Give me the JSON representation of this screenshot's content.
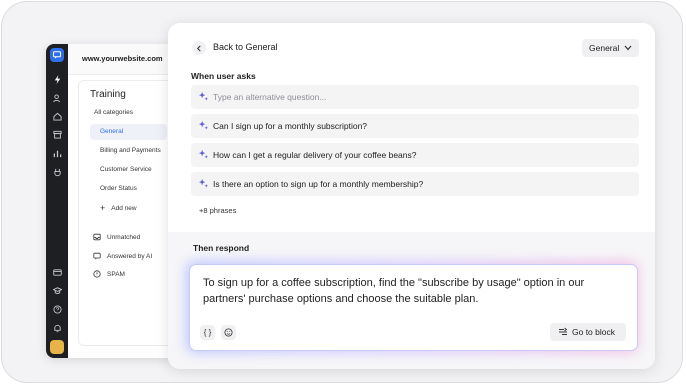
{
  "app": {
    "site": "www.yourwebsite.com",
    "training_title": "Training",
    "categories": [
      {
        "label": "All categories"
      },
      {
        "label": "General"
      },
      {
        "label": "Billing and Payments"
      },
      {
        "label": "Customer Service"
      },
      {
        "label": "Order Status"
      },
      {
        "label": "Add new"
      }
    ],
    "filters": [
      {
        "label": "Unmatched",
        "icon": "inbox-icon"
      },
      {
        "label": "Answered by AI",
        "icon": "ai-chat-icon"
      },
      {
        "label": "SPAM",
        "icon": "block-icon"
      }
    ]
  },
  "modal": {
    "back_label": "Back to General",
    "category_dropdown": "General",
    "ask_label": "When user asks",
    "placeholder": "Type an alternative question...",
    "questions": [
      "Can I sign up for a monthly subscription?",
      "How can I get a regular delivery of your coffee beans?",
      "Is there an option to sign up for a monthly membership?"
    ],
    "more_phrases": "+8 phrases",
    "respond_label": "Then respond",
    "response_text": "To sign up for a coffee subscription, find the \"subscribe by usage\" option in our partners' purchase options and choose the suitable plan.",
    "variables_label": "{ }",
    "goto_label": "Go to block"
  },
  "colors": {
    "accent": "#2f6fec",
    "spark": "#5b5bd6",
    "rail": "#1d1f23",
    "glow_start": "#b9c3ff",
    "glow_end": "#f3bde4"
  }
}
